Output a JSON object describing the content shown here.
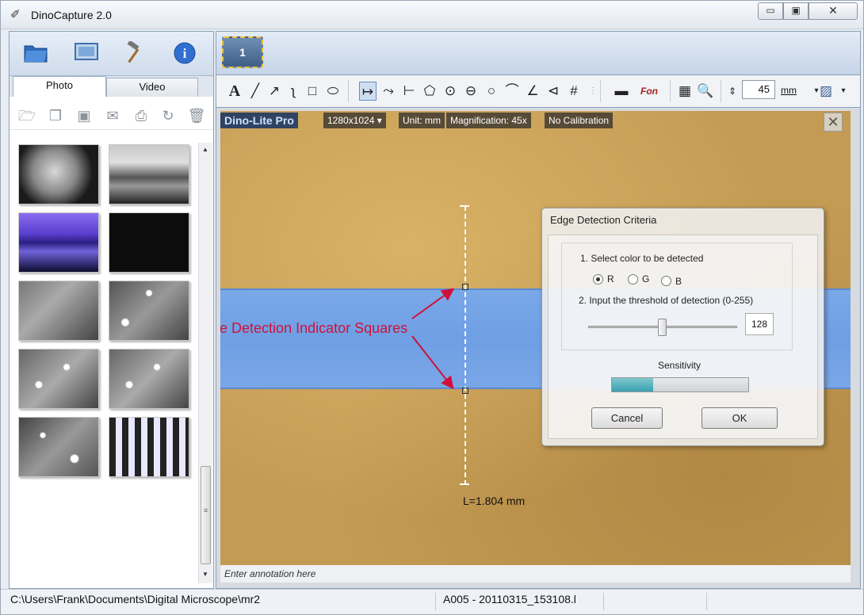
{
  "window": {
    "title": "DinoCapture 2.0",
    "min_label": "▭",
    "max_label": "▣",
    "close_label": "✕"
  },
  "left_panel": {
    "icons": [
      "folder-icon",
      "monitor-icon",
      "hammer-icon",
      "info-icon"
    ],
    "tabs": {
      "photo": "Photo",
      "video": "Video",
      "active": "Photo"
    },
    "photo_tools": [
      "open-icon",
      "copy-icon",
      "save-icon",
      "email-icon",
      "print-icon",
      "rotate-icon",
      "trash-icon"
    ],
    "thumbnails": [
      "thumb-1",
      "thumb-2",
      "thumb-3",
      "thumb-4",
      "thumb-5",
      "thumb-6",
      "thumb-7",
      "thumb-8",
      "thumb-9",
      "thumb-10"
    ]
  },
  "capture": {
    "camera_label": "1"
  },
  "toolbar": {
    "zoom_value": "45",
    "unit": "mm",
    "colors": {
      "selected_border": "#6a8bb8"
    }
  },
  "image": {
    "brand": "Dino-Lite Pro",
    "resolution": "1280x1024 ▾",
    "unit": "Unit: mm",
    "magnification": "Magnification:  45x",
    "calibration": "No Calibration",
    "annotation_text": "Edge Detection Indicator Squares",
    "measurement": "L=1.804 mm",
    "annotation_placeholder": "Enter annotation here",
    "colors": {
      "background": "#c49b53",
      "stripe": "#7aa8e8",
      "annotation": "#d0103a"
    }
  },
  "dialog": {
    "title": "Edge Detection Criteria",
    "step1": "1. Select color to be detected",
    "radio": {
      "r": "R",
      "g": "G",
      "b": "B",
      "selected": "R"
    },
    "step2": "2. Input the threshold of detection (0-255)",
    "threshold": "128",
    "threshold_value": 128,
    "sensitivity_label": "Sensitivity",
    "sensitivity_level": 0.3,
    "cancel": "Cancel",
    "ok": "OK"
  },
  "statusbar": {
    "path": "C:\\Users\\Frank\\Documents\\Digital Microscope\\mr2",
    "file": "A005 - 20110315_153108.l"
  }
}
